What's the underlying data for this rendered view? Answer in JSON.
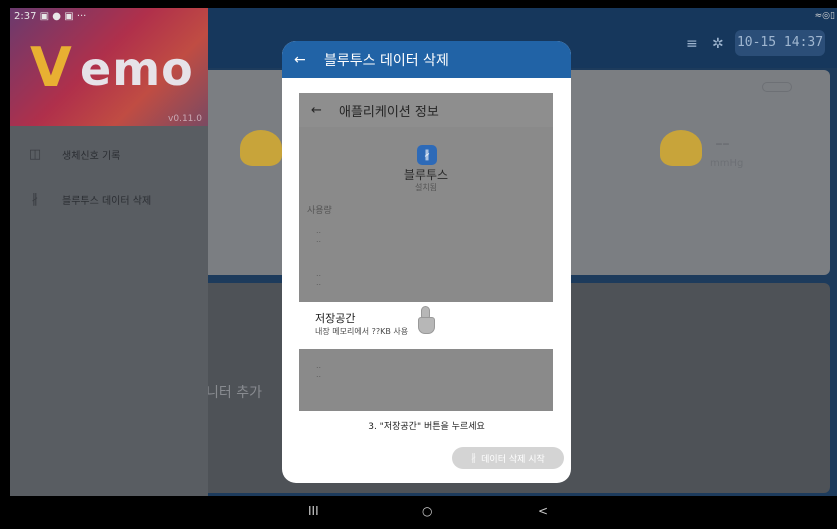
{
  "status_bar": {
    "time": "2:37",
    "notif_icons": "▣ ● ▣ ···",
    "right_icons": "≈◎▯"
  },
  "app": {
    "date_chip": "10-15 14:37",
    "add_data_label": "니터 추가",
    "card_value": "--",
    "card_sub": "mmHg"
  },
  "drawer": {
    "logo_v": "V",
    "logo_rest": "emo",
    "version": "v0.11.0",
    "items": [
      {
        "icon": "camera-icon",
        "glyph": "◫",
        "label": "생체신호 기록"
      },
      {
        "icon": "bluetooth-icon",
        "glyph": "∦",
        "label": "블루투스 데이터 삭제"
      }
    ]
  },
  "modal": {
    "back_glyph": "←",
    "title": "블루투스 데이터 삭제",
    "screenshot": {
      "header_back": "←",
      "header_title": "애플리케이션 정보",
      "app_icon_glyph": "∦",
      "app_name": "블루투스",
      "app_sub": "설치됨",
      "section": "사용량",
      "dots1": "..\n..",
      "dots2": "..\n..",
      "dots3": "..\n..",
      "storage_title": "저장공간",
      "storage_sub": "내장 메모리에서 ??KB 사용"
    },
    "instruction": "3. \"저장공간\" 버튼을 누르세요",
    "start_button_icon": "∦",
    "start_button_label": "데이터 삭제 시작"
  },
  "navbar": {
    "recent": "III",
    "home": "○",
    "back": "<"
  }
}
